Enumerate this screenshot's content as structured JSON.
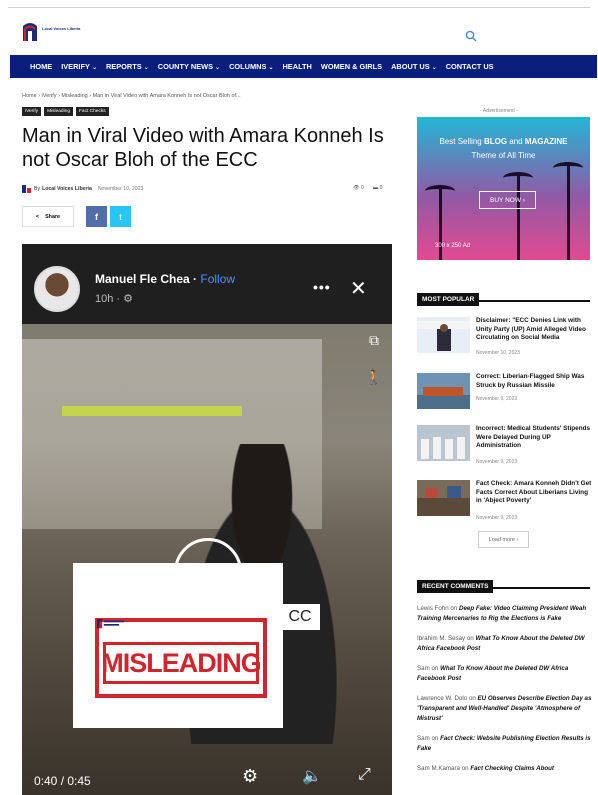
{
  "header": {
    "logo_text": "Local Voices Liberia",
    "search_icon": "search-icon"
  },
  "nav": {
    "items": [
      {
        "label": "HOME",
        "dropdown": false
      },
      {
        "label": "IVERIFY",
        "dropdown": true
      },
      {
        "label": "REPORTS",
        "dropdown": true
      },
      {
        "label": "COUNTY NEWS",
        "dropdown": true
      },
      {
        "label": "COLUMNS",
        "dropdown": true
      },
      {
        "label": "HEALTH",
        "dropdown": false
      },
      {
        "label": "WOMEN & GIRLS",
        "dropdown": false
      },
      {
        "label": "ABOUT US",
        "dropdown": true
      },
      {
        "label": "CONTACT US",
        "dropdown": false
      }
    ]
  },
  "article": {
    "breadcrumb": "Home › iVerify › Misleading › Man in Viral Video with Amara Konneh Is not Oscar Bloh of...",
    "tags": [
      "iVerify",
      "Misleading",
      "Fact Checks"
    ],
    "title": "Man in Viral Video with Amara Konneh Is not Oscar Bloh of the ECC",
    "by": "By",
    "author": "Local Voices Liberia",
    "date": "November 10, 2023",
    "views": "0",
    "comments": "0",
    "share_label": "Share",
    "fb_label": "f",
    "tw_label": "t"
  },
  "video": {
    "poster_name": "Manuel Fle Chea",
    "follow": "Follow",
    "age": "10h",
    "more": "•••",
    "close": "✕",
    "cc": "CC",
    "timecode": "0:40 / 0:45",
    "stamp": "MISLEADING"
  },
  "sidebar": {
    "ad_label": "- Advertisement -",
    "ad_line1_pre": "Best Selling ",
    "ad_line1_b1": "BLOG",
    "ad_line1_mid": " and ",
    "ad_line1_b2": "MAGAZINE",
    "ad_line2": "Theme of All Time",
    "ad_button": "BUY NOW  ›",
    "ad_size": "300 x 250 Ad",
    "most_popular": "MOST POPULAR",
    "popular": [
      {
        "title": "Disclaimer: \"ECC Denies Link with Unity Party (UP) Amid Alleged Video Circulating on Social Media",
        "date": "November 10, 2023"
      },
      {
        "title": "Correct: Liberian-Flagged Ship Was Struck by Russian Missile",
        "date": "November 9, 2023"
      },
      {
        "title": "Incorrect: Medical Students' Stipends Were Delayed During UP Administration",
        "date": "November 9, 2023"
      },
      {
        "title": "Fact Check: Amara Konneh Didn't Get Facts Correct About Liberians Living in 'Abject Poverty'",
        "date": "November 9, 2023"
      }
    ],
    "load_more": "Load more  ›",
    "recent_comments": "RECENT COMMENTS",
    "comments": [
      {
        "author": "Lewis Fohn",
        "on": " on ",
        "post": "Deep Fake: Video Claiming President Weah Training Mercenaries to Rig the Elections is Fake"
      },
      {
        "author": "Ibrahim M. Sesay",
        "on": " on ",
        "post": "What To Know About the Deleted DW Africa Facebook Post"
      },
      {
        "author": "Sam",
        "on": " on ",
        "post": "What To Know About the Deleted DW Africa Facebook Post"
      },
      {
        "author": "Lawrence W. Dolo",
        "on": " on ",
        "post": "EU Observes Describe Election Day as 'Transparent and Well-Handled' Despite 'Atmosphere of Mistrust'"
      },
      {
        "author": "Sam",
        "on": " on ",
        "post": "Fact Check: Website Publishing Election Results is Fake"
      },
      {
        "author": "Sam M.Kamara",
        "on": " on ",
        "post": "Fact Checking Claims About"
      }
    ]
  },
  "colors": {
    "nav_bg": "#0a1f7c",
    "stamp_red": "#d0252b",
    "facebook": "#516eab",
    "twitter": "#29c5f6"
  }
}
